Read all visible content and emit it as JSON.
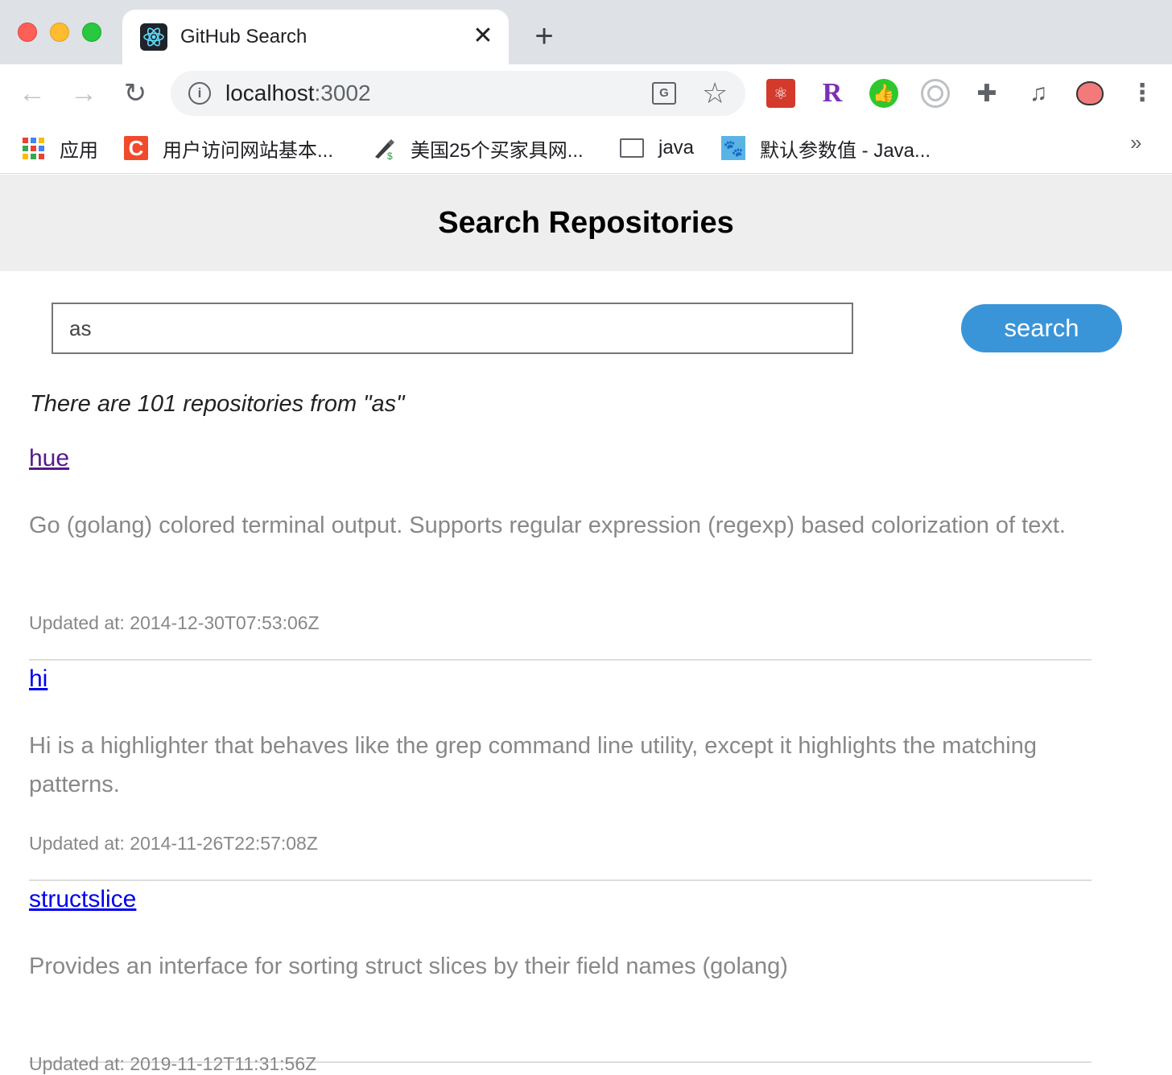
{
  "browser": {
    "tab": {
      "title": "GitHub Search",
      "close": "✕"
    },
    "new_tab": "+",
    "nav": {
      "back": "←",
      "forward": "→",
      "reload": "↻"
    },
    "address": {
      "host": "localhost",
      "port": ":3002"
    },
    "bookmarks": [
      {
        "label": "应用",
        "icon": "apps-grid-icon"
      },
      {
        "label": "用户访问网站基本...",
        "icon": "c-logo-icon"
      },
      {
        "label": "美国25个买家具网...",
        "icon": "pen-dollar-icon"
      },
      {
        "label": "java",
        "icon": "folder-icon"
      },
      {
        "label": "默认参数值 - Java...",
        "icon": "dog-icon"
      }
    ],
    "bookmarks_more": "»"
  },
  "page": {
    "title": "Search Repositories",
    "search": {
      "value": "as",
      "button_label": "search"
    },
    "result_count": "There are 101 repositories from \"as\"",
    "results": [
      {
        "name": "hue",
        "visited": true,
        "description": "Go (golang) colored terminal output. Supports regular expression (regexp) based colorization of text.",
        "updated": "Updated at: 2014-12-30T07:53:06Z"
      },
      {
        "name": "hi",
        "visited": false,
        "description": "Hi is a highlighter that behaves like the grep command line utility, except it highlights the matching patterns.",
        "updated": "Updated at: 2014-11-26T22:57:08Z"
      },
      {
        "name": "structslice",
        "visited": false,
        "description": "Provides an interface for sorting struct slices by their field names (golang)",
        "updated": "Updated at: 2019-11-12T11:31:56Z"
      }
    ]
  },
  "colors": {
    "accent_button": "#3a95d8",
    "link": "#0000ee",
    "link_visited": "#551a8b",
    "header_bg": "#eeeeee"
  }
}
